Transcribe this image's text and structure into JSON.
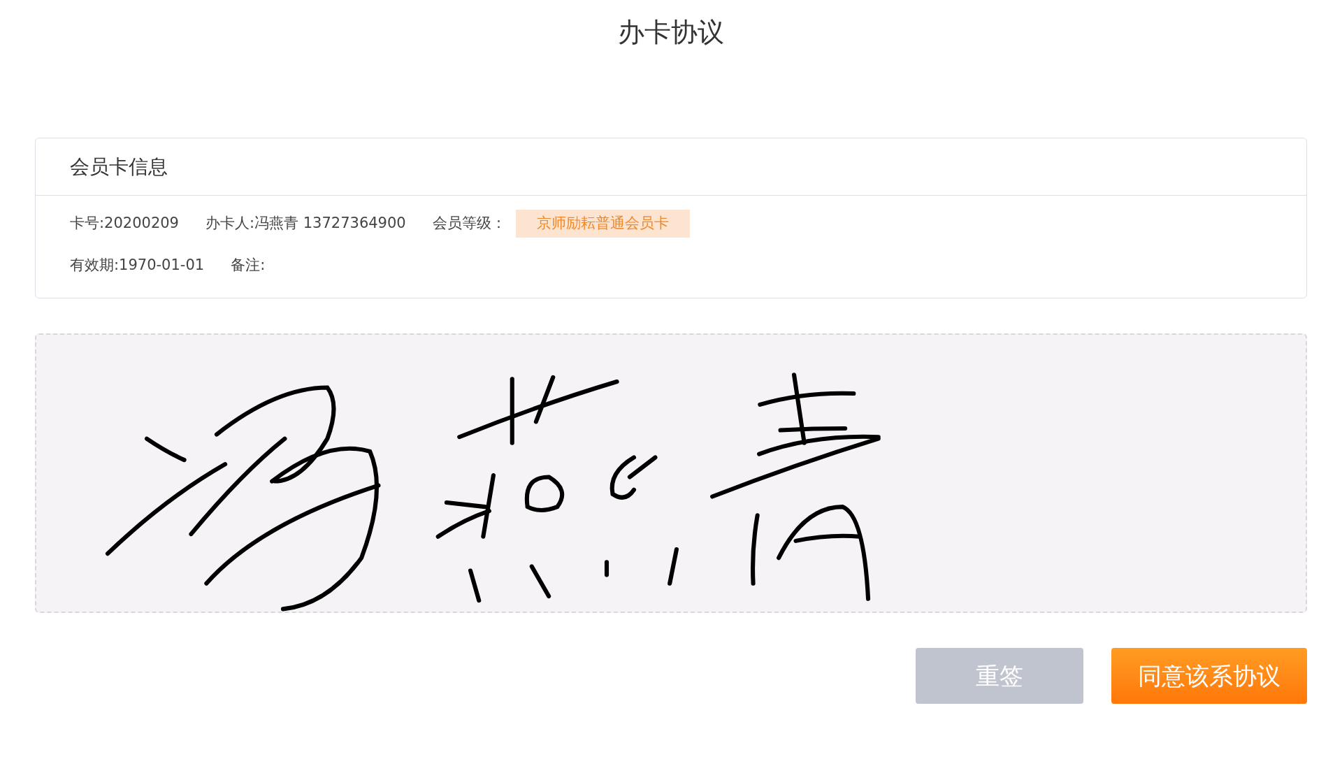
{
  "title": "办卡协议",
  "card": {
    "header": "会员卡信息",
    "rows": [
      [
        {
          "kind": "text",
          "text": "卡号:20200209"
        },
        {
          "kind": "text",
          "text": "办卡人:冯燕青 13727364900"
        },
        {
          "kind": "text",
          "text": "会员等级："
        },
        {
          "kind": "badge",
          "text": "京师励耘普通会员卡"
        }
      ],
      [
        {
          "kind": "text",
          "text": "有效期:1970-01-01"
        },
        {
          "kind": "text",
          "text": "备注:"
        }
      ]
    ]
  },
  "buttons": [
    {
      "label": "重签",
      "kind": "secondary"
    },
    {
      "label": "同意该系协议",
      "kind": "primary"
    }
  ]
}
